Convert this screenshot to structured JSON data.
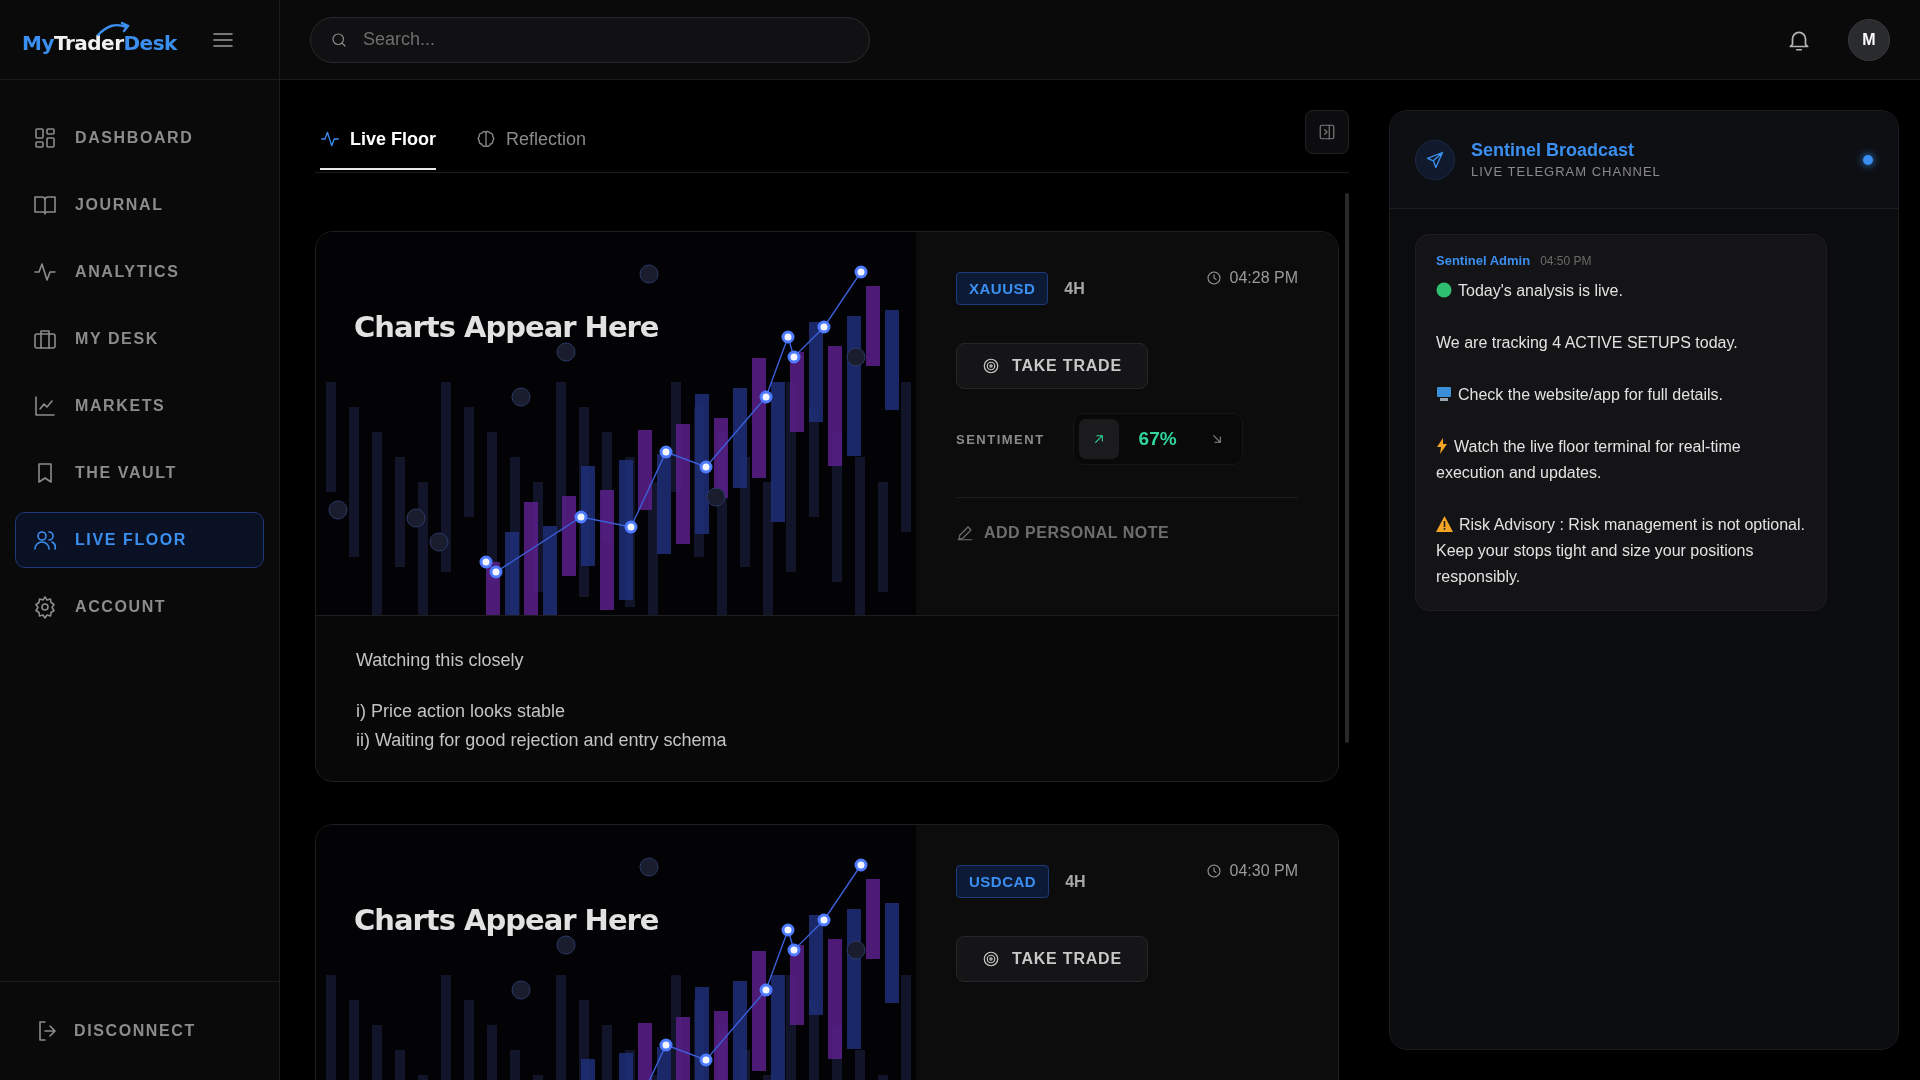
{
  "brand": {
    "part1": "My",
    "part2": "Trader",
    "part3": "Desk"
  },
  "search": {
    "placeholder": "Search..."
  },
  "avatar": {
    "initial": "M"
  },
  "sidebar": {
    "items": [
      {
        "label": "DASHBOARD",
        "kind": "grid",
        "selected": false
      },
      {
        "label": "JOURNAL",
        "kind": "book",
        "selected": false
      },
      {
        "label": "ANALYTICS",
        "kind": "pulse",
        "selected": false
      },
      {
        "label": "MY DESK",
        "kind": "briefcase",
        "selected": false
      },
      {
        "label": "MARKETS",
        "kind": "chart",
        "selected": false
      },
      {
        "label": "THE VAULT",
        "kind": "bookmark",
        "selected": false
      },
      {
        "label": "LIVE FLOOR",
        "kind": "users",
        "selected": true
      },
      {
        "label": "ACCOUNT",
        "kind": "gear",
        "selected": false
      }
    ],
    "footer": {
      "label": "DISCONNECT"
    }
  },
  "tabs": [
    {
      "label": "Live Floor",
      "kind": "pulse",
      "selected": true
    },
    {
      "label": "Reflection",
      "kind": "brain",
      "selected": false
    }
  ],
  "setups": [
    {
      "image": {
        "kind": "picture",
        "caption": "Charts Appear Here"
      },
      "symbol": "XAUUSD",
      "timeframe": "4H",
      "time": "04:28 PM",
      "action": "TAKE TRADE",
      "sentiment": {
        "label": "SENTIMENT",
        "reading": "67%",
        "directions": [
          {
            "kind": "up",
            "selected": true
          },
          {
            "kind": "down",
            "selected": false
          }
        ]
      },
      "note_action": "ADD PERSONAL NOTE",
      "note": {
        "title": "Watching this closely",
        "lines": [
          "i) Price action looks stable",
          "ii) Waiting for good rejection and entry schema"
        ]
      }
    },
    {
      "image": {
        "kind": "picture",
        "caption": "Charts Appear Here"
      },
      "symbol": "USDCAD",
      "timeframe": "4H",
      "time": "04:30 PM",
      "action": "TAKE TRADE"
    }
  ],
  "broadcast": {
    "title": "Sentinel Broadcast",
    "subtitle": "LIVE TELEGRAM CHANNEL",
    "live": true,
    "messages": [
      {
        "author": "Sentinel Admin",
        "time": "04:50 PM",
        "paragraphs": [
          {
            "kind": "status",
            "text": "Today's analysis is live."
          },
          {
            "kind": "plain",
            "text": "We are tracking 4 ACTIVE SETUPS today."
          },
          {
            "kind": "device",
            "text": "Check the website/app for full details."
          },
          {
            "kind": "alert",
            "text": "Watch the live floor terminal for real-time execution and updates."
          },
          {
            "kind": "warning",
            "text": "Risk Advisory : Risk management is not optional. Keep your stops tight and size your positions responsibly."
          }
        ]
      }
    ]
  }
}
